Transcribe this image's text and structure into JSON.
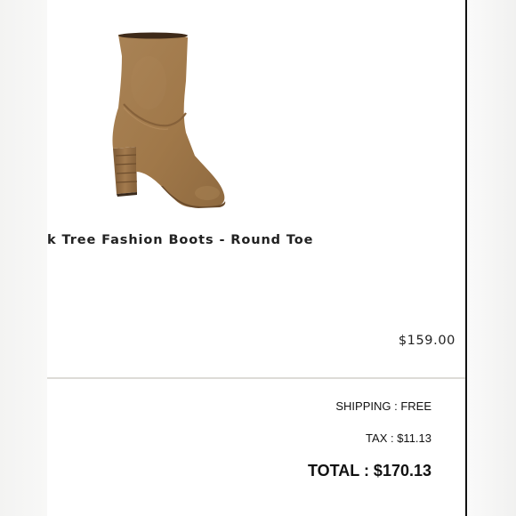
{
  "cart_item": {
    "image_icon": "suede-mid-calf-boot",
    "title": "k Tree Fashion Boots - Round Toe",
    "price": "$159.00"
  },
  "order_summary": {
    "shipping": "SHIPPING : FREE",
    "tax": "TAX : $11.13",
    "total": "TOTAL : $170.13"
  },
  "colors": {
    "boot_suede": "#a57d4f",
    "boot_heel": "#9a6f43",
    "divider": "#dddbd7",
    "panel_border": "#111111"
  }
}
